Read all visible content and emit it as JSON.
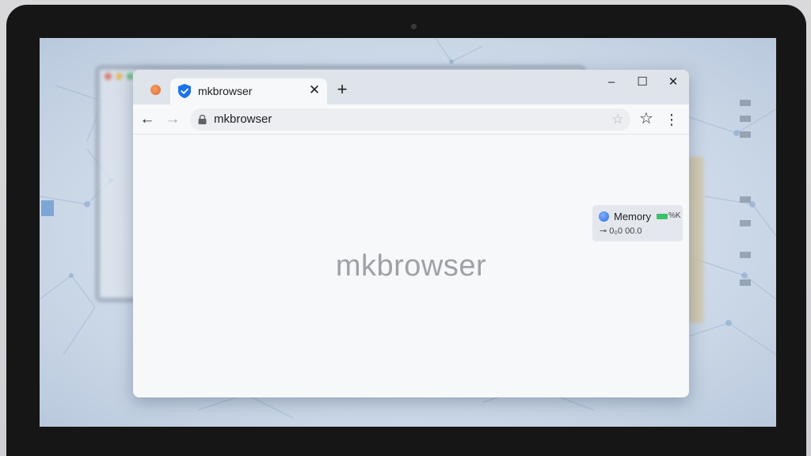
{
  "browser": {
    "tab": {
      "title": "mkbrowser",
      "close_glyph": "✕"
    },
    "new_tab_glyph": "+",
    "window_controls": {
      "minimize": "–",
      "maximize": "☐",
      "close": "✕"
    },
    "toolbar": {
      "back_glyph": "←",
      "forward_glyph": "→",
      "url": "mkbrowser",
      "bookmark_star_glyph": "☆",
      "star_glyph": "☆",
      "menu_glyph": "⋮"
    },
    "content": {
      "brand_text": "mkbrowser",
      "close_glyph": "✕"
    },
    "memory_widget": {
      "label": "Memory",
      "percent_text": "%K",
      "value": "⊸ 0₀0 00.0",
      "bar_color": "#3fc06a"
    }
  },
  "colors": {
    "accent_blue": "#1a73e8",
    "favicon_orange": "#e8663a",
    "titlebar": "#dfe3ea"
  }
}
